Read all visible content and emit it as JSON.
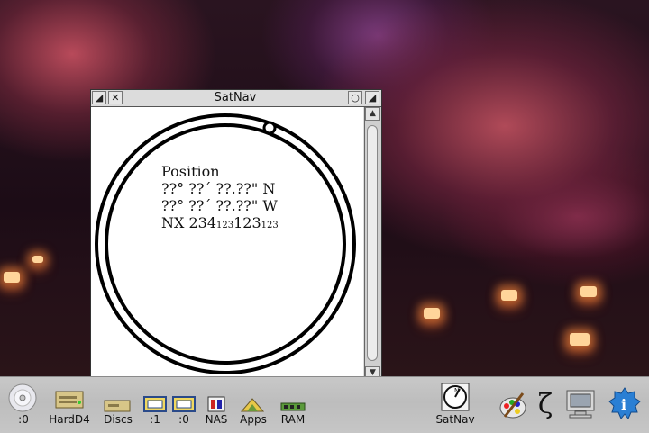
{
  "window": {
    "title": "SatNav",
    "position": {
      "heading": "Position",
      "latitude": "??° ??´ ??.??\" N",
      "longitude": "??° ??´ ??.??\" W",
      "grid_prefix": "NX",
      "easting_main": "234",
      "easting_small": "123",
      "northing_main": "123",
      "northing_small": "123"
    }
  },
  "iconbar": {
    "left": [
      {
        "label": ":0",
        "icon": "cd-drive-icon"
      },
      {
        "label": "HardD4",
        "icon": "hard-drive-icon"
      },
      {
        "label": "Discs",
        "icon": "discs-icon"
      },
      {
        "label": ":1",
        "icon": "floppy-drive-icon"
      },
      {
        "label": ":0",
        "icon": "floppy-drive-icon"
      },
      {
        "label": "NAS",
        "icon": "nas-icon"
      },
      {
        "label": "Apps",
        "icon": "apps-icon"
      },
      {
        "label": "RAM",
        "icon": "ram-disc-icon"
      }
    ],
    "right": [
      {
        "label": "SatNav",
        "icon": "satnav-compass-icon"
      },
      {
        "label": "",
        "icon": "paint-palette-icon"
      },
      {
        "label": "",
        "icon": "zeta-icon"
      },
      {
        "label": "",
        "icon": "display-monitor-icon"
      },
      {
        "label": "",
        "icon": "info-icon"
      }
    ]
  },
  "colors": {
    "window_background": "#ffffff",
    "iconbar_background": "#c4c4c4",
    "info_icon_blue": "#2a7fd4"
  }
}
